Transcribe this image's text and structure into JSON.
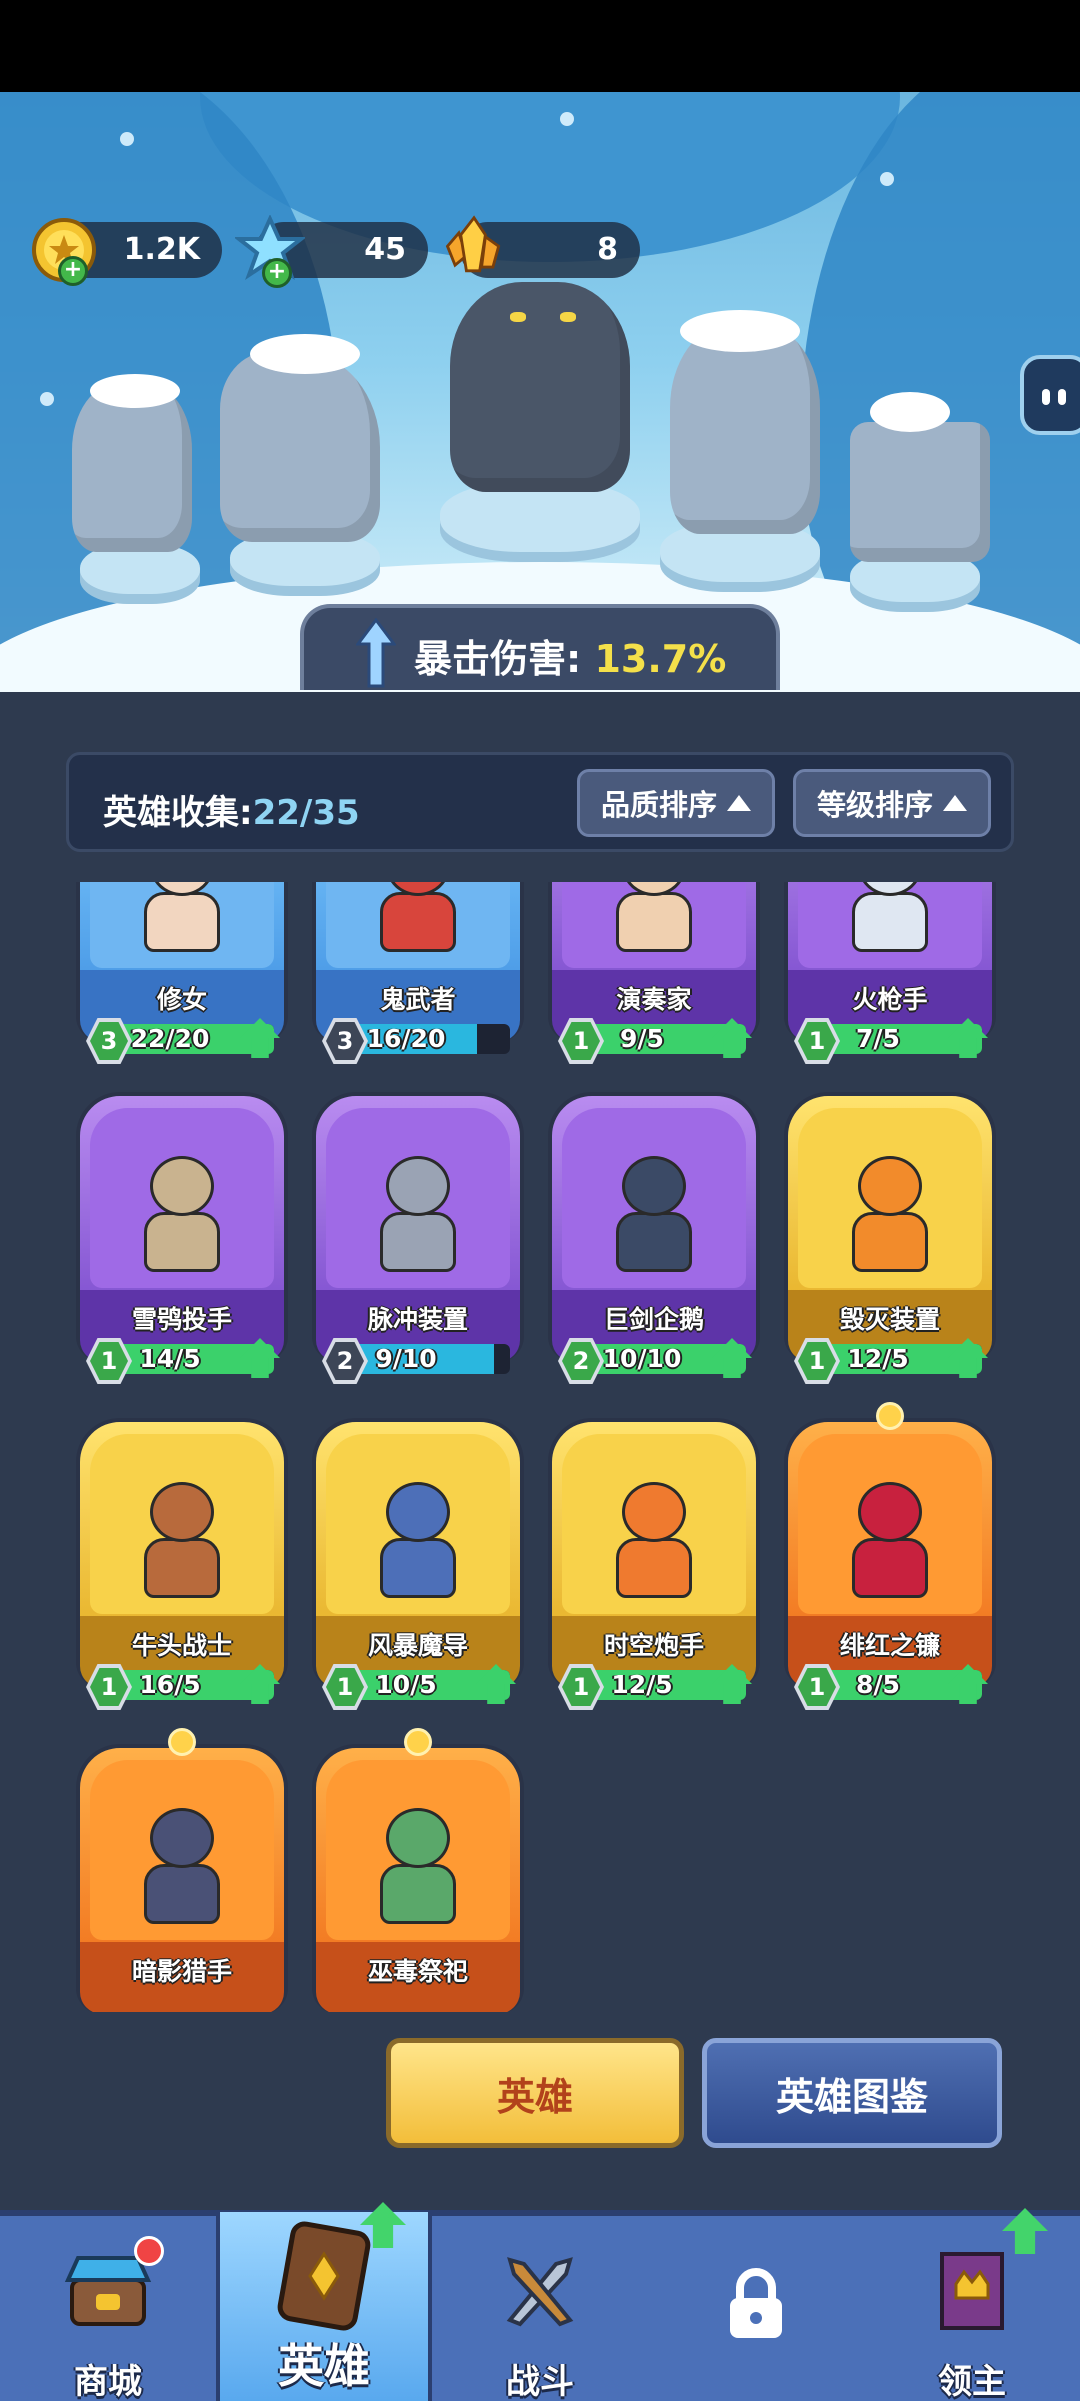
{
  "currency": {
    "gold": "1.2K",
    "gems": "45",
    "crystals": "8"
  },
  "banner": {
    "label": "暴击伤害:",
    "value": "13.7%"
  },
  "collection": {
    "label": "英雄收集:",
    "count": "22/35",
    "sort_quality": "品质排序",
    "sort_level": "等级排序"
  },
  "heroes": [
    {
      "name": "修女",
      "level": "3",
      "progress": "22/20",
      "fill": 1.0,
      "rarity": "blue",
      "color": "#f2d6c0"
    },
    {
      "name": "鬼武者",
      "level": "3",
      "progress": "16/20",
      "fill": 0.8,
      "rarity": "blue",
      "color": "#d8453c"
    },
    {
      "name": "演奏家",
      "level": "1",
      "progress": "9/5",
      "fill": 1.0,
      "rarity": "purple",
      "color": "#f0d0b0"
    },
    {
      "name": "火枪手",
      "level": "1",
      "progress": "7/5",
      "fill": 1.0,
      "rarity": "purple",
      "color": "#dfe7f2"
    },
    {
      "name": "雪鸮投手",
      "level": "1",
      "progress": "14/5",
      "fill": 1.0,
      "rarity": "purple",
      "color": "#c9b38f"
    },
    {
      "name": "脉冲装置",
      "level": "2",
      "progress": "9/10",
      "fill": 0.9,
      "rarity": "purple",
      "color": "#9aa3b4"
    },
    {
      "name": "巨剑企鹅",
      "level": "2",
      "progress": "10/10",
      "fill": 1.0,
      "rarity": "purple",
      "color": "#3b4a66"
    },
    {
      "name": "毁灭装置",
      "level": "1",
      "progress": "12/5",
      "fill": 1.0,
      "rarity": "gold",
      "color": "#f28b2b"
    },
    {
      "name": "牛头战士",
      "level": "1",
      "progress": "16/5",
      "fill": 1.0,
      "rarity": "gold",
      "color": "#b86a3c"
    },
    {
      "name": "风暴魔导",
      "level": "1",
      "progress": "10/5",
      "fill": 1.0,
      "rarity": "gold",
      "color": "#4d6fb8"
    },
    {
      "name": "时空炮手",
      "level": "1",
      "progress": "12/5",
      "fill": 1.0,
      "rarity": "gold",
      "color": "#ef7a2f"
    },
    {
      "name": "绯红之镰",
      "level": "1",
      "progress": "8/5",
      "fill": 1.0,
      "rarity": "orange",
      "color": "#c8213e"
    },
    {
      "name": "暗影猎手",
      "level": "",
      "progress": "",
      "fill": 0,
      "rarity": "orange",
      "color": "#4a5176"
    },
    {
      "name": "巫毒祭祀",
      "level": "",
      "progress": "",
      "fill": 0,
      "rarity": "orange",
      "color": "#5aa86a"
    }
  ],
  "actions": {
    "heroes": "英雄",
    "codex": "英雄图鉴"
  },
  "nav": {
    "shop": "商城",
    "heroes": "英雄",
    "battle": "战斗",
    "lord": "领主"
  }
}
